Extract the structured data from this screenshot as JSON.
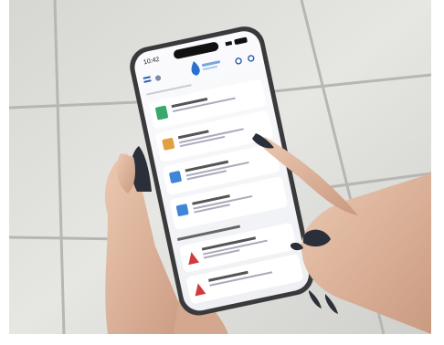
{
  "status_bar": {
    "time": "10:42",
    "signal": "signal-icon",
    "battery": "battery-icon"
  },
  "app": {
    "logo": "water-drop-logo",
    "header_icons": [
      "menu-icon",
      "back-icon",
      "search-icon",
      "profile-icon"
    ],
    "items": [
      {
        "icon": "document-icon",
        "accent": "#3aa86b"
      },
      {
        "icon": "folder-icon",
        "accent": "#e0a040"
      },
      {
        "icon": "box-icon",
        "accent": "#3f86d6"
      },
      {
        "icon": "grid-icon",
        "accent": "#3f86d6"
      },
      {
        "icon": "warning-icon",
        "accent": "#d23b3b"
      },
      {
        "icon": "warning-icon",
        "accent": "#d23b3b"
      }
    ]
  },
  "colors": {
    "floor": "#dcdcd8",
    "grout": "#b8b9b5",
    "phone_frame": "#3a3a3c",
    "screen": "#f4f5f7",
    "skin": "#e2b9a0",
    "nails": "#2a2f3a"
  }
}
